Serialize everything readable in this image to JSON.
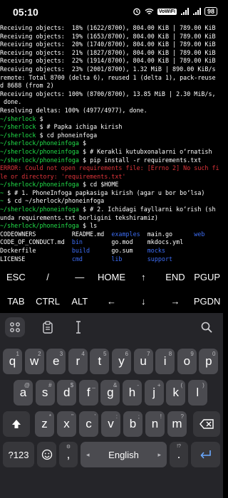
{
  "status": {
    "time": "05:10",
    "vowifi": "VoWiFi",
    "battery": "98"
  },
  "terminal": {
    "lines": [
      [
        {
          "t": "Receiving objects:  18% (1622/8700), 804.00 KiB | 789.00 KiB",
          "c": ""
        }
      ],
      [
        {
          "t": "Receiving objects:  19% (1653/8700), 804.00 KiB | 789.00 KiB",
          "c": ""
        }
      ],
      [
        {
          "t": "Receiving objects:  20% (1740/8700), 804.00 KiB | 789.00 KiB",
          "c": ""
        }
      ],
      [
        {
          "t": "Receiving objects:  21% (1827/8700), 804.00 KiB | 789.00 KiB",
          "c": ""
        }
      ],
      [
        {
          "t": "Receiving objects:  22% (1914/8700), 804.00 KiB | 789.00 KiB",
          "c": ""
        }
      ],
      [
        {
          "t": "Receiving objects:  23% (2001/8700), 1.32 MiB | 890.00 KiB/s",
          "c": ""
        }
      ],
      [
        {
          "t": "remote: Total 8700 (delta 6), reused 1 (delta 1), pack-reuse",
          "c": ""
        }
      ],
      [
        {
          "t": "d 8688 (from 2)",
          "c": ""
        }
      ],
      [
        {
          "t": "Receiving objects: 100% (8700/8700), 13.85 MiB | 2.30 MiB/s,",
          "c": ""
        }
      ],
      [
        {
          "t": " done.",
          "c": ""
        }
      ],
      [
        {
          "t": "Resolving deltas: 100% (4977/4977), done.",
          "c": ""
        }
      ],
      [
        {
          "t": "~/sherlock",
          "c": "g"
        },
        {
          "t": " $",
          "c": ""
        }
      ],
      [
        {
          "t": "~/sherlock",
          "c": "g"
        },
        {
          "t": " $ # Papka ichiga kirish",
          "c": ""
        }
      ],
      [
        {
          "t": "~/sherlock",
          "c": "g"
        },
        {
          "t": " $ cd phoneinfoga",
          "c": ""
        }
      ],
      [
        {
          "t": "~/sherlock/phoneinfoga",
          "c": "g"
        },
        {
          "t": " $",
          "c": ""
        }
      ],
      [
        {
          "t": "~/sherlock/phoneinfoga",
          "c": "g"
        },
        {
          "t": " $ # Kerakli kutubxonalarni o‘rnatish",
          "c": ""
        }
      ],
      [
        {
          "t": "~/sherlock/phoneinfoga",
          "c": "g"
        },
        {
          "t": " $ pip install -r requirements.txt",
          "c": ""
        }
      ],
      [
        {
          "t": "ERROR: Could not open requirements file: [Errno 2] No such fi",
          "c": "r"
        }
      ],
      [
        {
          "t": "le or directory: 'requirements.txt'",
          "c": "r"
        }
      ],
      [
        {
          "t": "~/sherlock/phoneinfoga",
          "c": "g"
        },
        {
          "t": " $ cd $HOME",
          "c": ""
        }
      ],
      [
        {
          "t": "~",
          "c": "g"
        },
        {
          "t": " $ # 1. PhoneInfoga papkasiga kirish (agar u bor bo‘lsa)",
          "c": ""
        }
      ],
      [
        {
          "t": "~",
          "c": "g"
        },
        {
          "t": " $ cd ~/sherlock/phoneinfoga",
          "c": ""
        }
      ],
      [
        {
          "t": "~/sherlock/phoneinfoga",
          "c": "g"
        },
        {
          "t": " $ # 2. Ichidagi fayllarni ko‘rish (sh",
          "c": ""
        }
      ],
      [
        {
          "t": "unda requirements.txt borligini tekshiramiz)",
          "c": ""
        }
      ],
      [
        {
          "t": "~/sherlock/phoneinfoga",
          "c": "g"
        },
        {
          "t": " $ ls",
          "c": ""
        }
      ],
      [
        {
          "t": "CODEOWNERS          README.md  ",
          "c": ""
        },
        {
          "t": "examples",
          "c": "b"
        },
        {
          "t": "  main.go      ",
          "c": ""
        },
        {
          "t": "web",
          "c": "b"
        }
      ],
      [
        {
          "t": "CODE_OF_CONDUCT.md  ",
          "c": ""
        },
        {
          "t": "bin",
          "c": "b"
        },
        {
          "t": "        go.mod    mkdocs.yml",
          "c": ""
        }
      ],
      [
        {
          "t": "Dockerfile          ",
          "c": ""
        },
        {
          "t": "build",
          "c": "b"
        },
        {
          "t": "      go.sum    ",
          "c": ""
        },
        {
          "t": "mocks",
          "c": "b"
        }
      ],
      [
        {
          "t": "LICENSE             ",
          "c": ""
        },
        {
          "t": "cmd",
          "c": "b"
        },
        {
          "t": "        ",
          "c": ""
        },
        {
          "t": "lib",
          "c": "b"
        },
        {
          "t": "       ",
          "c": ""
        },
        {
          "t": "support",
          "c": "b"
        }
      ],
      [
        {
          "t": "Makefile            ",
          "c": ""
        },
        {
          "t": "docs",
          "c": "b"
        },
        {
          "t": "       ",
          "c": ""
        },
        {
          "t": "logs",
          "c": "b"
        },
        {
          "t": "      ",
          "c": ""
        },
        {
          "t": "test",
          "c": "b"
        }
      ],
      [
        {
          "t": "~/sherlock/phoneinfoga",
          "c": "g"
        },
        {
          "t": " $ ",
          "c": ""
        }
      ]
    ]
  },
  "extra_keys": {
    "row1": [
      "ESC",
      "/",
      "—",
      "HOME",
      "↑",
      "END",
      "PGUP"
    ],
    "row2": [
      "TAB",
      "CTRL",
      "ALT",
      "←",
      "↓",
      "→",
      "PGDN"
    ]
  },
  "keyboard": {
    "row1": [
      {
        "k": "q",
        "s": "1"
      },
      {
        "k": "w",
        "s": "2"
      },
      {
        "k": "e",
        "s": "3"
      },
      {
        "k": "r",
        "s": "4"
      },
      {
        "k": "t",
        "s": "5"
      },
      {
        "k": "y",
        "s": "6"
      },
      {
        "k": "u",
        "s": "7"
      },
      {
        "k": "i",
        "s": "8"
      },
      {
        "k": "o",
        "s": "9"
      },
      {
        "k": "p",
        "s": "0"
      }
    ],
    "row2": [
      {
        "k": "a",
        "s": "@"
      },
      {
        "k": "s",
        "s": "#"
      },
      {
        "k": "d",
        "s": "$"
      },
      {
        "k": "f",
        "s": "_"
      },
      {
        "k": "g",
        "s": "&"
      },
      {
        "k": "h",
        "s": "-"
      },
      {
        "k": "j",
        "s": "+"
      },
      {
        "k": "k",
        "s": "("
      },
      {
        "k": "l",
        "s": ")"
      }
    ],
    "row3": [
      {
        "k": "z",
        "s": "*"
      },
      {
        "k": "x",
        "s": "\""
      },
      {
        "k": "c",
        "s": "'"
      },
      {
        "k": "v",
        "s": ":"
      },
      {
        "k": "b",
        "s": ";"
      },
      {
        "k": "n",
        "s": "!"
      },
      {
        "k": "m",
        "s": "?"
      }
    ],
    "symbols_label": "?123",
    "comma": ",",
    "period": ".",
    "space_label": "English",
    "comma_hint": "⚙",
    "period_hint": "!?"
  }
}
